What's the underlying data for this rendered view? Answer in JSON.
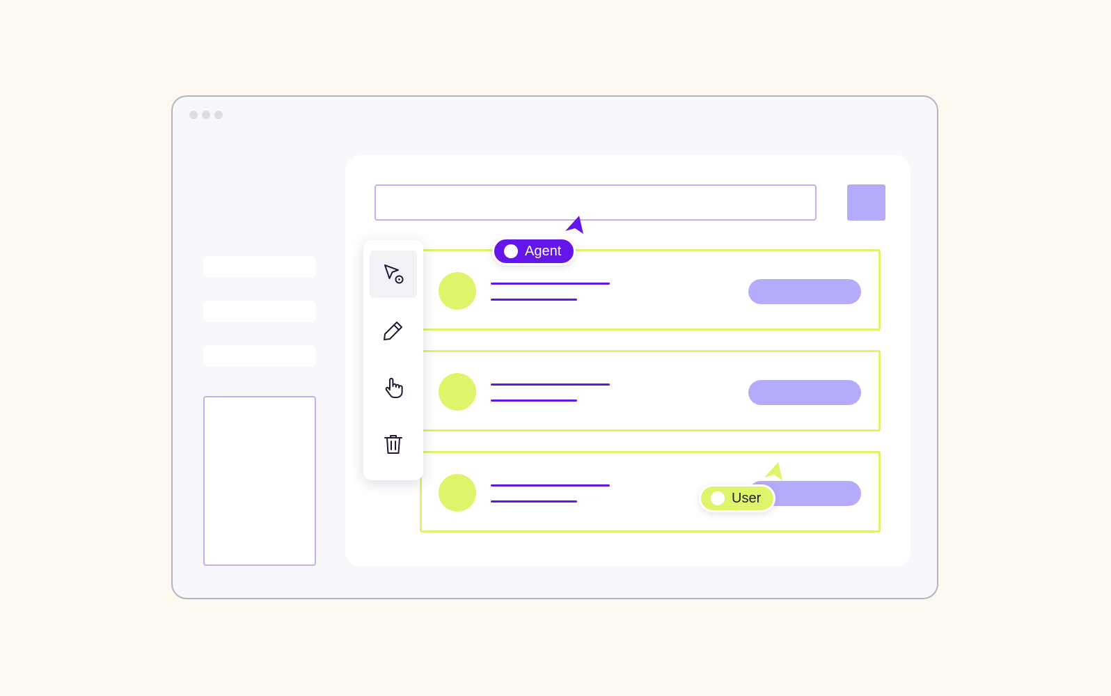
{
  "window": {
    "controls": [
      "dot",
      "dot",
      "dot"
    ]
  },
  "sidebar": {
    "items": [
      "",
      "",
      ""
    ]
  },
  "toolbar": {
    "tools": [
      {
        "icon": "cursor-pointer-icon",
        "active": true
      },
      {
        "icon": "pencil-icon",
        "active": false
      },
      {
        "icon": "hand-pointer-icon",
        "active": false
      },
      {
        "icon": "trash-icon",
        "active": false
      }
    ]
  },
  "cursors": {
    "agent": {
      "label": "Agent",
      "color": "#6415ea"
    },
    "user": {
      "label": "User",
      "color": "#def46a"
    }
  },
  "rows": [
    {
      "id": 1
    },
    {
      "id": 2
    },
    {
      "id": 3
    }
  ],
  "colors": {
    "background": "#fdf9f1",
    "window": "#f8f8fc",
    "accent_purple": "#6417e2",
    "accent_lavender": "#b4abfb",
    "accent_lime": "#dcf36e"
  }
}
